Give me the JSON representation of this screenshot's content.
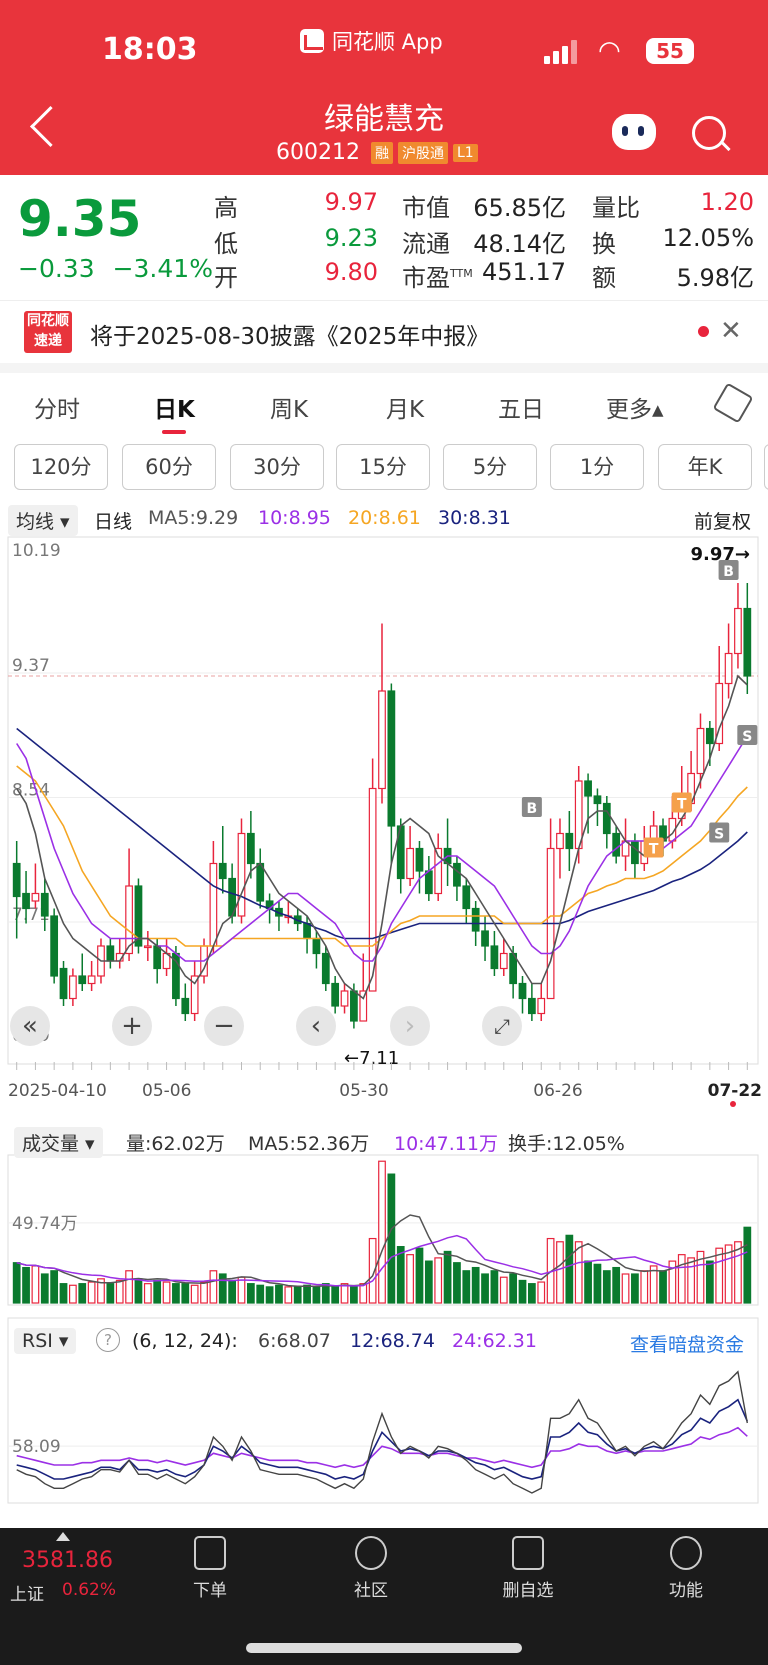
{
  "status_bar": {
    "time": "18:03",
    "app_label": "同花顺 App",
    "battery": "55"
  },
  "header": {
    "stock_name": "绿能慧充",
    "stock_code": "600212",
    "tags": [
      "融",
      "沪股通",
      "L1"
    ]
  },
  "quote": {
    "price": "9.35",
    "change": "−0.33",
    "change_pct": "−3.41%",
    "fields": [
      {
        "label": "高",
        "value": "9.97"
      },
      {
        "label": "低",
        "value": "9.23"
      },
      {
        "label": "开",
        "value": "9.80"
      },
      {
        "label": "市值",
        "value": "65.85亿"
      },
      {
        "label": "流通",
        "value": "48.14亿"
      },
      {
        "label": "市盈",
        "sup": "TTM",
        "value": "451.17"
      },
      {
        "label": "量比",
        "value": "1.20"
      },
      {
        "label": "换",
        "value": "12.05%"
      },
      {
        "label": "额",
        "value": "5.98亿"
      }
    ]
  },
  "notice": {
    "logo_line1": "同花顺",
    "logo_line2": "速递",
    "text": "将于2025-08-30披露《2025年中报》"
  },
  "tabs": [
    "分时",
    "日K",
    "周K",
    "月K",
    "五日",
    "更多▴"
  ],
  "active_tab": "日K",
  "intervals": [
    "120分",
    "60分",
    "30分",
    "15分",
    "5分",
    "1分",
    "年K"
  ],
  "kline_header": {
    "type": "均线",
    "period": "日线",
    "ma5": "MA5:9.29",
    "ma10": "10:8.95",
    "ma20": "20:8.61",
    "ma30": "30:8.31",
    "adjust": "前复权"
  },
  "colors": {
    "up": "#e8243c",
    "down": "#0a7a2e",
    "ma5": "#555555",
    "ma10": "#9b30e6",
    "ma20": "#f5a623",
    "ma30": "#1a237e"
  },
  "chart_data": {
    "type": "candlestick",
    "price_axis_labels": [
      "10.19",
      "9.37",
      "8.54",
      "7.71",
      "6.89"
    ],
    "ylim": [
      6.89,
      10.19
    ],
    "date_labels": [
      "2025-04-10",
      "05-06",
      "05-30",
      "06-26",
      "07-22"
    ],
    "annotations": {
      "high": "9.97→",
      "low": "←7.11",
      "price_line": 9.35
    },
    "trade_marks": [
      "B",
      "B",
      "T",
      "T",
      "S",
      "S"
    ],
    "candles": [
      [
        8.1,
        7.88,
        8.25,
        7.6
      ],
      [
        7.9,
        7.8,
        8.05,
        7.7
      ],
      [
        7.85,
        7.9,
        8.1,
        7.8
      ],
      [
        7.9,
        7.75,
        8.0,
        7.65
      ],
      [
        7.75,
        7.35,
        7.8,
        7.3
      ],
      [
        7.4,
        7.2,
        7.45,
        7.15
      ],
      [
        7.2,
        7.35,
        7.4,
        7.15
      ],
      [
        7.35,
        7.3,
        7.5,
        7.25
      ],
      [
        7.3,
        7.35,
        7.45,
        7.25
      ],
      [
        7.35,
        7.55,
        7.6,
        7.3
      ],
      [
        7.55,
        7.45,
        7.6,
        7.4
      ],
      [
        7.45,
        7.5,
        7.6,
        7.4
      ],
      [
        7.5,
        7.95,
        8.2,
        7.45
      ],
      [
        7.95,
        7.55,
        8.0,
        7.5
      ],
      [
        7.55,
        7.55,
        7.65,
        7.45
      ],
      [
        7.55,
        7.4,
        7.6,
        7.3
      ],
      [
        7.4,
        7.5,
        7.6,
        7.35
      ],
      [
        7.5,
        7.2,
        7.55,
        7.15
      ],
      [
        7.2,
        7.1,
        7.3,
        7.05
      ],
      [
        7.1,
        7.35,
        7.45,
        7.05
      ],
      [
        7.35,
        7.55,
        7.6,
        7.3
      ],
      [
        7.55,
        8.1,
        8.25,
        7.5
      ],
      [
        8.1,
        8.0,
        8.35,
        7.9
      ],
      [
        8.0,
        7.75,
        8.1,
        7.7
      ],
      [
        7.75,
        8.3,
        8.4,
        7.7
      ],
      [
        8.3,
        8.1,
        8.45,
        8.0
      ],
      [
        8.1,
        7.85,
        8.2,
        7.8
      ],
      [
        7.85,
        7.8,
        7.9,
        7.7
      ],
      [
        7.8,
        7.75,
        7.85,
        7.65
      ],
      [
        7.75,
        7.75,
        7.85,
        7.7
      ],
      [
        7.75,
        7.7,
        7.8,
        7.65
      ],
      [
        7.7,
        7.6,
        7.75,
        7.5
      ],
      [
        7.6,
        7.5,
        7.65,
        7.4
      ],
      [
        7.5,
        7.3,
        7.55,
        7.25
      ],
      [
        7.3,
        7.15,
        7.35,
        7.1
      ],
      [
        7.15,
        7.25,
        7.3,
        7.1
      ],
      [
        7.25,
        7.05,
        7.3,
        7.0
      ],
      [
        7.05,
        7.25,
        7.5,
        7.11
      ],
      [
        7.25,
        8.6,
        8.8,
        7.8
      ],
      [
        8.6,
        9.25,
        9.7,
        8.5
      ],
      [
        9.25,
        8.35,
        9.3,
        8.1
      ],
      [
        8.35,
        8.0,
        8.4,
        7.9
      ],
      [
        8.0,
        8.2,
        8.35,
        7.95
      ],
      [
        8.2,
        8.05,
        8.25,
        7.9
      ],
      [
        8.05,
        7.9,
        8.15,
        7.85
      ],
      [
        7.9,
        8.2,
        8.3,
        7.85
      ],
      [
        8.2,
        8.1,
        8.4,
        7.95
      ],
      [
        8.1,
        7.95,
        8.15,
        7.85
      ],
      [
        7.95,
        7.8,
        8.0,
        7.7
      ],
      [
        7.8,
        7.65,
        7.85,
        7.55
      ],
      [
        7.65,
        7.55,
        7.75,
        7.45
      ],
      [
        7.55,
        7.4,
        7.65,
        7.35
      ],
      [
        7.4,
        7.5,
        7.6,
        7.35
      ],
      [
        7.5,
        7.3,
        7.55,
        7.2
      ],
      [
        7.3,
        7.2,
        7.35,
        7.1
      ],
      [
        7.2,
        7.1,
        7.3,
        7.05
      ],
      [
        7.1,
        7.2,
        7.3,
        7.05
      ],
      [
        7.2,
        8.2,
        8.4,
        7.2
      ],
      [
        8.2,
        8.3,
        8.4,
        8.0
      ],
      [
        8.3,
        8.2,
        8.45,
        8.05
      ],
      [
        8.2,
        8.65,
        8.75,
        8.1
      ],
      [
        8.65,
        8.55,
        8.7,
        8.3
      ],
      [
        8.55,
        8.5,
        8.6,
        8.35
      ],
      [
        8.5,
        8.3,
        8.55,
        8.2
      ],
      [
        8.3,
        8.15,
        8.35,
        8.1
      ],
      [
        8.15,
        8.25,
        8.4,
        8.05
      ],
      [
        8.25,
        8.1,
        8.3,
        8.0
      ],
      [
        8.1,
        8.25,
        8.35,
        8.05
      ],
      [
        8.25,
        8.35,
        8.45,
        8.2
      ],
      [
        8.35,
        8.25,
        8.4,
        8.15
      ],
      [
        8.25,
        8.4,
        8.55,
        8.2
      ],
      [
        8.4,
        8.5,
        8.75,
        8.35
      ],
      [
        8.5,
        8.7,
        8.85,
        8.45
      ],
      [
        8.7,
        9.0,
        9.1,
        8.6
      ],
      [
        9.0,
        8.9,
        9.05,
        8.75
      ],
      [
        8.9,
        9.3,
        9.55,
        8.85
      ],
      [
        9.3,
        9.5,
        9.7,
        9.2
      ],
      [
        9.5,
        9.8,
        9.97,
        9.4
      ],
      [
        9.8,
        9.35,
        9.97,
        9.23
      ]
    ],
    "ma5": [
      8.6,
      8.5,
      8.3,
      8.0,
      7.85,
      7.7,
      7.6,
      7.55,
      7.5,
      7.45,
      7.45,
      7.45,
      7.55,
      7.6,
      7.6,
      7.55,
      7.5,
      7.45,
      7.35,
      7.3,
      7.4,
      7.55,
      7.7,
      7.75,
      7.9,
      8.05,
      8.1,
      8.0,
      7.9,
      7.85,
      7.8,
      7.75,
      7.65,
      7.55,
      7.4,
      7.3,
      7.25,
      7.2,
      7.35,
      7.7,
      8.1,
      8.35,
      8.4,
      8.35,
      8.3,
      8.15,
      8.1,
      8.05,
      8.0,
      7.9,
      7.8,
      7.7,
      7.6,
      7.5,
      7.4,
      7.3,
      7.3,
      7.45,
      7.7,
      7.95,
      8.2,
      8.4,
      8.45,
      8.45,
      8.35,
      8.25,
      8.2,
      8.15,
      8.2,
      8.25,
      8.3,
      8.4,
      8.5,
      8.65,
      8.8,
      9.0,
      9.15,
      9.35,
      9.29
    ],
    "ma10": [
      8.9,
      8.8,
      8.6,
      8.4,
      8.2,
      8.05,
      7.9,
      7.8,
      7.7,
      7.65,
      7.6,
      7.6,
      7.6,
      7.6,
      7.6,
      7.55,
      7.55,
      7.5,
      7.45,
      7.45,
      7.45,
      7.5,
      7.55,
      7.6,
      7.65,
      7.7,
      7.75,
      7.8,
      7.85,
      7.9,
      7.9,
      7.85,
      7.8,
      7.75,
      7.7,
      7.6,
      7.5,
      7.45,
      7.45,
      7.55,
      7.7,
      7.8,
      7.9,
      8.0,
      8.05,
      8.1,
      8.15,
      8.15,
      8.1,
      8.05,
      8.0,
      7.95,
      7.85,
      7.75,
      7.65,
      7.55,
      7.5,
      7.5,
      7.55,
      7.65,
      7.8,
      7.95,
      8.05,
      8.15,
      8.2,
      8.25,
      8.25,
      8.25,
      8.2,
      8.2,
      8.25,
      8.3,
      8.35,
      8.45,
      8.55,
      8.65,
      8.75,
      8.85,
      8.95
    ],
    "ma20": [
      8.75,
      8.7,
      8.65,
      8.55,
      8.45,
      8.35,
      8.2,
      8.05,
      7.95,
      7.85,
      7.75,
      7.7,
      7.65,
      7.6,
      7.6,
      7.6,
      7.6,
      7.6,
      7.55,
      7.55,
      7.55,
      7.55,
      7.55,
      7.6,
      7.6,
      7.6,
      7.6,
      7.6,
      7.6,
      7.6,
      7.6,
      7.6,
      7.6,
      7.6,
      7.6,
      7.55,
      7.55,
      7.55,
      7.55,
      7.6,
      7.65,
      7.7,
      7.72,
      7.75,
      7.75,
      7.75,
      7.75,
      7.75,
      7.75,
      7.75,
      7.75,
      7.75,
      7.7,
      7.7,
      7.7,
      7.7,
      7.7,
      7.75,
      7.75,
      7.8,
      7.85,
      7.9,
      7.92,
      7.95,
      7.97,
      8.0,
      8.0,
      8.0,
      8.02,
      8.05,
      8.1,
      8.15,
      8.2,
      8.25,
      8.32,
      8.4,
      8.47,
      8.55,
      8.61
    ],
    "ma30": [
      9.0,
      8.95,
      8.9,
      8.85,
      8.8,
      8.75,
      8.7,
      8.65,
      8.6,
      8.55,
      8.5,
      8.45,
      8.4,
      8.35,
      8.3,
      8.25,
      8.2,
      8.15,
      8.1,
      8.05,
      8.0,
      7.95,
      7.92,
      7.9,
      7.88,
      7.85,
      7.82,
      7.8,
      7.77,
      7.75,
      7.72,
      7.7,
      7.67,
      7.65,
      7.62,
      7.6,
      7.6,
      7.6,
      7.6,
      7.62,
      7.64,
      7.66,
      7.68,
      7.7,
      7.7,
      7.7,
      7.7,
      7.7,
      7.7,
      7.7,
      7.7,
      7.7,
      7.7,
      7.7,
      7.7,
      7.7,
      7.7,
      7.7,
      7.7,
      7.72,
      7.75,
      7.78,
      7.8,
      7.82,
      7.84,
      7.86,
      7.88,
      7.9,
      7.92,
      7.95,
      7.98,
      8.0,
      8.03,
      8.06,
      8.1,
      8.15,
      8.2,
      8.25,
      8.31
    ],
    "volume_header": {
      "type": "成交量",
      "vol": "量:62.02万",
      "ma5": "MA5:52.36万",
      "ma10": "10:47.11万",
      "turnover": "换手:12.05%",
      "axis_label": "49.74万"
    },
    "volume_axis_max": 90,
    "volume": [
      25,
      22,
      23,
      18,
      20,
      12,
      11,
      12,
      13,
      15,
      12,
      14,
      20,
      15,
      12,
      14,
      13,
      12,
      12,
      11,
      13,
      20,
      18,
      14,
      16,
      12,
      11,
      10,
      11,
      10,
      10,
      11,
      10,
      12,
      10,
      12,
      10,
      12,
      40,
      88,
      80,
      35,
      30,
      34,
      26,
      28,
      32,
      25,
      20,
      22,
      18,
      20,
      16,
      18,
      14,
      12,
      13,
      40,
      38,
      42,
      38,
      26,
      24,
      20,
      22,
      18,
      18,
      20,
      23,
      20,
      26,
      30,
      28,
      32,
      26,
      34,
      36,
      38,
      47
    ],
    "rsi_header": {
      "type": "RSI",
      "params": "(6, 12, 24):",
      "rsi6": "6:68.07",
      "rsi12": "12:68.74",
      "rsi24": "24:62.31",
      "link": "查看暗盘资金",
      "axis_label": "58.09"
    },
    "rsi_ylim": [
      35,
      95
    ],
    "rsi6": [
      48,
      46,
      45,
      42,
      40,
      40,
      42,
      44,
      45,
      48,
      48,
      47,
      52,
      46,
      46,
      44,
      46,
      44,
      42,
      45,
      50,
      62,
      58,
      52,
      62,
      56,
      48,
      47,
      46,
      46,
      46,
      45,
      44,
      42,
      40,
      42,
      40,
      44,
      60,
      72,
      62,
      55,
      58,
      56,
      53,
      58,
      57,
      55,
      52,
      48,
      46,
      44,
      46,
      42,
      40,
      38,
      40,
      70,
      70,
      72,
      78,
      70,
      68,
      62,
      56,
      58,
      54,
      58,
      60,
      57,
      62,
      68,
      72,
      80,
      76,
      84,
      86,
      90,
      68
    ],
    "rsi12": [
      50,
      49,
      48,
      46,
      44,
      44,
      45,
      46,
      47,
      49,
      49,
      48,
      52,
      48,
      48,
      47,
      48,
      46,
      45,
      47,
      50,
      58,
      56,
      53,
      58,
      55,
      51,
      50,
      49,
      49,
      49,
      48,
      47,
      46,
      44,
      45,
      44,
      46,
      56,
      64,
      60,
      56,
      57,
      56,
      54,
      56,
      56,
      55,
      53,
      51,
      50,
      48,
      49,
      47,
      45,
      44,
      45,
      62,
      62,
      64,
      68,
      64,
      63,
      59,
      56,
      57,
      55,
      57,
      58,
      57,
      59,
      63,
      65,
      70,
      68,
      73,
      75,
      78,
      68.74
    ],
    "rsi24": [
      54,
      53,
      52,
      51,
      50,
      50,
      50,
      51,
      51,
      52,
      52,
      52,
      53,
      52,
      52,
      51,
      52,
      51,
      50,
      51,
      52,
      55,
      54,
      53,
      55,
      54,
      53,
      52,
      52,
      52,
      52,
      51,
      51,
      50,
      49,
      50,
      49,
      50,
      54,
      58,
      57,
      55,
      55,
      55,
      54,
      55,
      55,
      54,
      53,
      53,
      52,
      51,
      52,
      51,
      50,
      49,
      50,
      56,
      56,
      57,
      59,
      58,
      58,
      56,
      55,
      56,
      55,
      56,
      56,
      56,
      57,
      58,
      59,
      62,
      61,
      63,
      64,
      66,
      62.31
    ]
  },
  "bottom_nav": {
    "index_value": "3581.86",
    "index_name": "上证",
    "index_change": "0.62%",
    "items": [
      "下单",
      "社区",
      "删自选",
      "功能"
    ]
  }
}
